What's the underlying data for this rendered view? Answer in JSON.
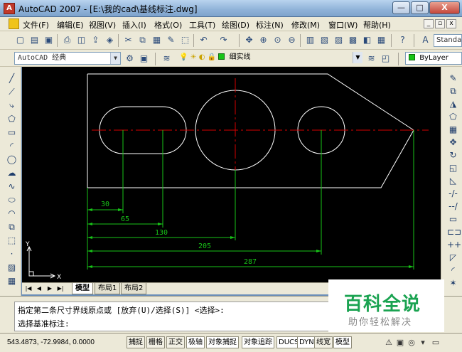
{
  "window": {
    "title": "AutoCAD 2007 - [E:\\我的cad\\基线标注.dwg]",
    "app_icon_glyph": "A",
    "minimize": "—",
    "maximize": "□",
    "close": "X"
  },
  "menubar": {
    "items": [
      "文件(F)",
      "编辑(E)",
      "视图(V)",
      "插入(I)",
      "格式(O)",
      "工具(T)",
      "绘图(D)",
      "标注(N)",
      "修改(M)",
      "窗口(W)",
      "帮助(H)"
    ],
    "mdi_min": "_",
    "mdi_restore": "▫",
    "mdi_close": "x"
  },
  "toolbar_standard": {
    "icons": [
      "new-icon",
      "open-icon",
      "save-icon",
      "plot-icon",
      "plot-preview-icon",
      "publish-icon",
      "3d-dwf-icon",
      "cut-icon",
      "copy-icon",
      "paste-icon",
      "match-properties-icon",
      "block-editor-icon",
      "undo-icon",
      "redo-icon",
      "pan-icon",
      "zoom-realtime-icon",
      "zoom-window-icon",
      "zoom-previous-icon",
      "properties-icon",
      "design-center-icon",
      "tool-palettes-icon",
      "sheet-set-icon",
      "markup-icon",
      "quickcalc-icon",
      "help-icon",
      "text-style-icon"
    ],
    "text_style": "Standa"
  },
  "toolbar_workspace": {
    "workspace": "AutoCAD 经典",
    "layer": "细实线",
    "linetype": "ByLayer",
    "colors": {
      "layer_swatch": "#18c418"
    }
  },
  "left_toolbar": {
    "icons": [
      "line-icon",
      "construction-line-icon",
      "polyline-icon",
      "polygon-icon",
      "rectangle-icon",
      "arc-icon",
      "circle-icon",
      "revision-cloud-icon",
      "spline-icon",
      "ellipse-icon",
      "ellipse-arc-icon",
      "insert-block-icon",
      "make-block-icon",
      "point-icon",
      "hatch-icon",
      "gradient-icon"
    ]
  },
  "right_toolbar": {
    "icons": [
      "erase-icon",
      "copy-object-icon",
      "mirror-icon",
      "offset-icon",
      "array-icon",
      "move-icon",
      "rotate-icon",
      "scale-icon",
      "stretch-icon",
      "trim-icon",
      "extend-icon",
      "break-at-point-icon",
      "break-icon",
      "join-icon",
      "chamfer-icon",
      "fillet-icon",
      "explode-icon"
    ]
  },
  "drawing": {
    "dimensions": [
      "30",
      "65",
      "130",
      "205",
      "287"
    ],
    "ucs_x": "X",
    "ucs_y": "Y",
    "colors": {
      "background": "#000000",
      "outline": "#ffffff",
      "centerline": "#d40000",
      "dimension": "#18c418"
    }
  },
  "layout_tabs": {
    "nav": [
      "|◀",
      "◀",
      "▶",
      "▶|"
    ],
    "tabs": [
      "模型",
      "布局1",
      "布局2"
    ],
    "active": "模型"
  },
  "command": {
    "line1": "指定第二条尺寸界线原点或 [放弃(U)/选择(S)] <选择>:",
    "line2": "选择基准标注:"
  },
  "watermark": {
    "title": "百科全说",
    "subtitle": "助你轻松解决"
  },
  "statusbar": {
    "coords": "543.4873, -72.9984, 0.0000",
    "buttons": [
      "捕捉",
      "栅格",
      "正交",
      "极轴",
      "对象捕捉",
      "对象追踪",
      "DUCS",
      "DYN",
      "线宽",
      "模型"
    ],
    "on_buttons": [
      "极轴",
      "对象捕捉",
      "对象追踪",
      "DUCS",
      "DYN",
      "模型"
    ]
  }
}
